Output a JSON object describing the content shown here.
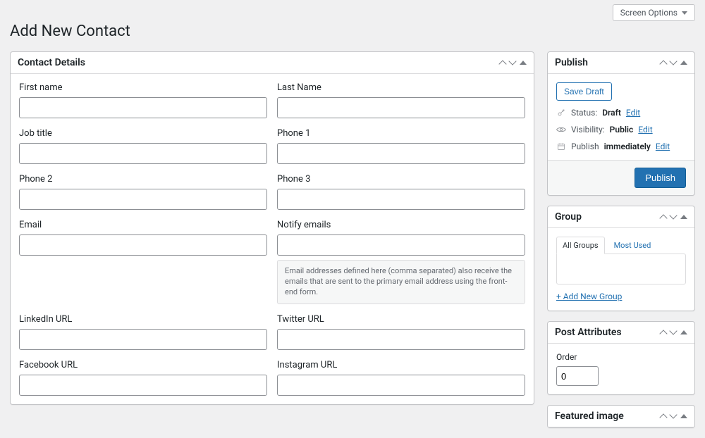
{
  "header": {
    "screen_options": "Screen Options",
    "page_title": "Add New Contact"
  },
  "contact_box": {
    "title": "Contact Details",
    "fields": {
      "first_name": "First name",
      "last_name": "Last Name",
      "job_title": "Job title",
      "phone1": "Phone 1",
      "phone2": "Phone 2",
      "phone3": "Phone 3",
      "email": "Email",
      "notify_emails": "Notify emails",
      "notify_hint": "Email addresses defined here (comma separated) also receive the emails that are sent to the primary email address using the front-end form.",
      "linkedin": "LinkedIn URL",
      "twitter": "Twitter URL",
      "facebook": "Facebook URL",
      "instagram": "Instagram URL"
    }
  },
  "publish": {
    "title": "Publish",
    "save_draft": "Save Draft",
    "status_label": "Status:",
    "status_value": "Draft",
    "visibility_label": "Visibility:",
    "visibility_value": "Public",
    "schedule_label": "Publish",
    "schedule_value": "immediately",
    "edit": "Edit",
    "publish_button": "Publish"
  },
  "group": {
    "title": "Group",
    "tab_all": "All Groups",
    "tab_most_used": "Most Used",
    "add_new": "+ Add New Group"
  },
  "attributes": {
    "title": "Post Attributes",
    "order_label": "Order",
    "order_value": "0"
  },
  "featured": {
    "title": "Featured image"
  }
}
